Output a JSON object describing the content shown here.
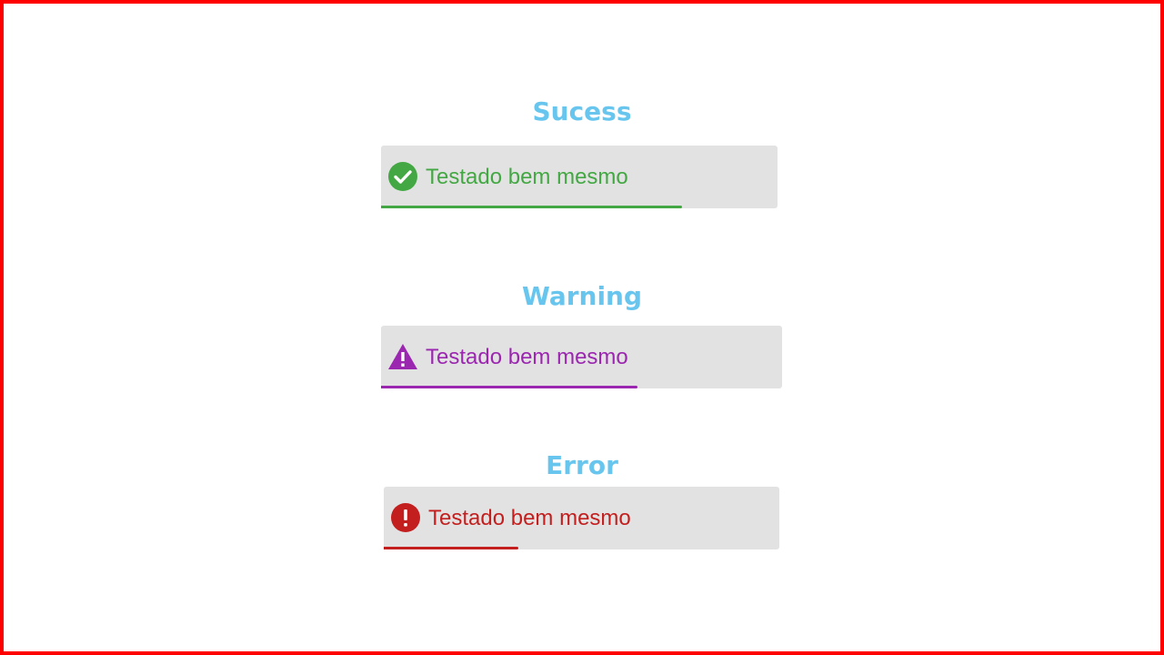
{
  "toasts": [
    {
      "heading": "Sucess",
      "message": "Testado bem mesmo",
      "icon": "check-circle-icon",
      "color": "#43a843",
      "progress_percent": 76
    },
    {
      "heading": "Warning",
      "message": "Testado bem mesmo",
      "icon": "warning-triangle-icon",
      "color": "#9b27b0",
      "progress_percent": 64
    },
    {
      "heading": "Error",
      "message": "Testado bem mesmo",
      "icon": "exclamation-circle-icon",
      "color": "#c31f1f",
      "progress_percent": 34
    }
  ],
  "colors": {
    "heading": "#68c6ee",
    "toast_background": "#e2e2e2",
    "frame_border": "#ff0000"
  }
}
